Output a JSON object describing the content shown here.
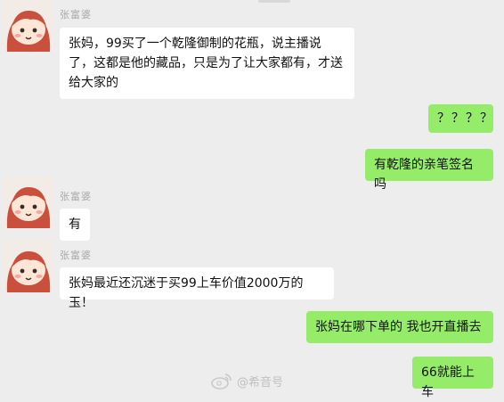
{
  "chat": {
    "messages": [
      {
        "sender": "张富婆",
        "text": "张妈，99买了一个乾隆御制的花瓶，说主播说了，这都是他的藏品，只是为了让大家都有，才送给大家的"
      },
      {
        "text": "？？？？"
      },
      {
        "text": "有乾隆的亲笔签名吗"
      },
      {
        "sender": "张富婆",
        "text": "有"
      },
      {
        "sender": "张富婆",
        "text": "张妈最近还沉迷于买99上车价值2000万的玉！"
      },
      {
        "text": "张妈在哪下单的  我也开直播去"
      },
      {
        "text": "66就能上车"
      }
    ]
  },
  "watermark": {
    "text": "@希音号"
  },
  "colors": {
    "background": "#ededed",
    "incoming_bubble": "#ffffff",
    "outgoing_bubble": "#95ec69",
    "avatar_hair": "#c8503c",
    "avatar_bg": "#f3ece6"
  }
}
